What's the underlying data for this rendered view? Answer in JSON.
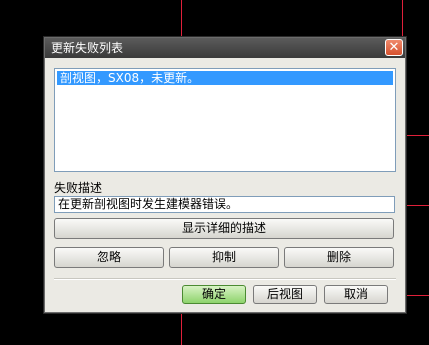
{
  "dialog": {
    "title": "更新失败列表",
    "close_glyph": "✕",
    "failed_list": [
      "剖视图，SX08，未更新。"
    ],
    "description_label": "失败描述",
    "description_text": "在更新剖视图时发生建模器错误。",
    "buttons": {
      "show_detail": "显示详细的描述",
      "ignore": "忽略",
      "suppress": "抑制",
      "delete": "删除",
      "ok": "确定",
      "back_view": "后视图",
      "cancel": "取消"
    }
  },
  "colors": {
    "background": "#000000",
    "cad_line": "#e0203a",
    "selection": "#3399ff",
    "ok_button": "#8ed36c",
    "close_button": "#d5512e"
  }
}
